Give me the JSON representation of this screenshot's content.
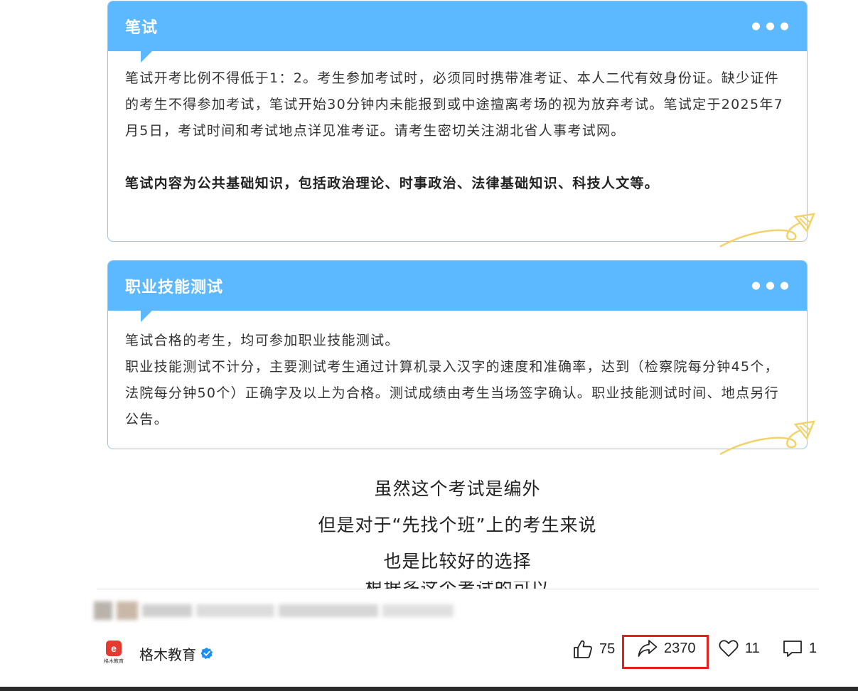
{
  "cards": [
    {
      "title": "笔试",
      "paragraphs": [
        "笔试开考比例不得低于1：2。考生参加考试时，必须同时携带准考证、本人二代有效身份证。缺少证件的考生不得参加考试，笔试开始30分钟内未能报到或中途擅离考场的视为放弃考试。笔试定于2025年7月5日，考试时间和考试地点详见准考证。请考生密切关注湖北省人事考试网。"
      ],
      "bold": "笔试内容为公共基础知识，包括政治理论、时事政治、法律基础知识、科技人文等。"
    },
    {
      "title": "职业技能测试",
      "paragraphs": [
        "笔试合格的考生，均可参加职业技能测试。",
        "职业技能测试不计分，主要测试考生通过计算机录入汉字的速度和准确率，达到（检察院每分钟45个，法院每分钟50个）正确字及以上为合格。测试成绩由考生当场签字确认。职业技能测试时间、地点另行公告。"
      ]
    }
  ],
  "center_lines": [
    "虽然这个考试是编外",
    "但是对于“先找个班”上的考生来说",
    "也是比较好的选择",
    "根据多这个考试的可以"
  ],
  "author": {
    "name": "格木教育",
    "logo_text": "格木教育",
    "logo_letter": "e",
    "verified_icon": "verified-badge-icon"
  },
  "actions": {
    "likes": "75",
    "shares": "2370",
    "favorites": "11",
    "comments": "1"
  },
  "colors": {
    "header_blue": "#5cb8ff",
    "border_blue": "#8fc8f4",
    "highlight_red": "#e0221f",
    "deco_yellow": "#f2d36b",
    "verified_blue": "#1d8ff2"
  }
}
